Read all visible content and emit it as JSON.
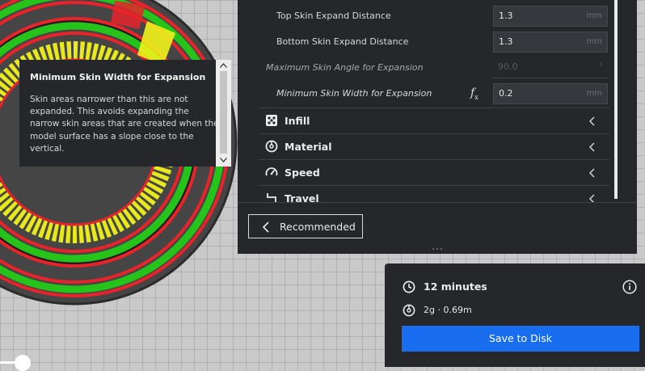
{
  "settings": {
    "rows": [
      {
        "label": "Top Skin Expand Distance",
        "value": "1.3",
        "unit": "mm",
        "italic": false,
        "enabled": true
      },
      {
        "label": "Bottom Skin Expand Distance",
        "value": "1.3",
        "unit": "mm",
        "italic": false,
        "enabled": true
      },
      {
        "label": "Maximum Skin Angle for Expansion",
        "value": "90.0",
        "unit": "°",
        "italic": true,
        "enabled": false
      },
      {
        "label": "Minimum Skin Width for Expansion",
        "value": "0.2",
        "unit": "mm",
        "italic": true,
        "enabled": true,
        "has_fx": true
      }
    ],
    "fx_symbol": "f",
    "fx_sub": "x",
    "categories": [
      {
        "label": "Infill",
        "icon": "infill-icon"
      },
      {
        "label": "Material",
        "icon": "material-icon"
      },
      {
        "label": "Speed",
        "icon": "speed-icon"
      },
      {
        "label": "Travel",
        "icon": "travel-icon"
      }
    ],
    "recommended_label": "Recommended"
  },
  "tooltip": {
    "title": "Minimum Skin Width for Expansion",
    "body": "Skin areas narrower than this are not expanded. This avoids expanding the narrow skin areas that are created when the model surface has a slope close to the vertical."
  },
  "print_info": {
    "time": "12 minutes",
    "material": "2g · 0.69m",
    "save_label": "Save to Disk"
  },
  "colors": {
    "panel_bg": "#25272a",
    "accent_blue": "#196ef0",
    "wall_red": "#e8232a",
    "wall_green": "#26c41a",
    "skin_yellow": "#f1f21b"
  }
}
